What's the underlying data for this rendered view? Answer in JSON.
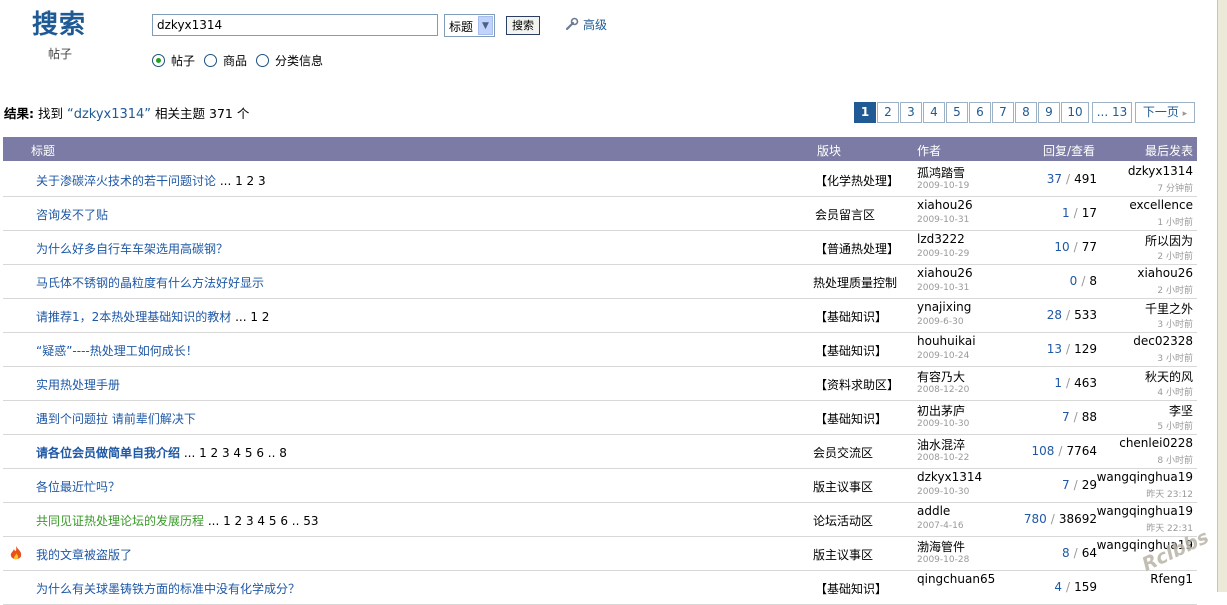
{
  "header": {
    "brand": "搜索",
    "brand_sub": "帖子",
    "query": "dzkyx1314",
    "field_value": "标题",
    "search_label": "搜索",
    "advanced_label": "高级",
    "scopes": [
      "帖子",
      "商品",
      "分类信息"
    ]
  },
  "result": {
    "prefix": "结果:",
    "found": " 找到 ",
    "keyword": "“dzkyx1314”",
    "suffix": " 相关主题 371 个"
  },
  "pager": {
    "pages": [
      "1",
      "2",
      "3",
      "4",
      "5",
      "6",
      "7",
      "8",
      "9",
      "10",
      "... 13"
    ],
    "next": "下一页"
  },
  "table": {
    "headers": [
      "标题",
      "版块",
      "作者",
      "回复/查看",
      "最后发表"
    ],
    "rows": [
      {
        "title": "关于渗碳淬火技术的若干问题讨论",
        "pages": " ... 1 2 3",
        "style": "blue",
        "forum": "【化学热处理】",
        "author": "孤鸿踏雪",
        "adate": "2009-10-19",
        "replies": "37",
        "views": "491",
        "last": "dzkyx1314",
        "ltime": "7 分钟前"
      },
      {
        "title": "咨询发不了贴",
        "pages": "",
        "style": "",
        "forum": "会员留言区",
        "author": "xiahou26",
        "adate": "2009-10-31",
        "replies": "1",
        "views": "17",
        "last": "excellence",
        "ltime": "1 小时前"
      },
      {
        "title": "为什么好多自行车车架选用高碳钢？",
        "pages": "",
        "style": "",
        "forum": "【普通热处理】",
        "author": "lzd3222",
        "adate": "2009-10-29",
        "replies": "10",
        "views": "77",
        "last": "所以因为",
        "ltime": "2 小时前"
      },
      {
        "title": "马氏体不锈钢的晶粒度有什么方法好好显示",
        "pages": "",
        "style": "",
        "forum": "热处理质量控制",
        "author": "xiahou26",
        "adate": "2009-10-31",
        "replies": "0",
        "views": "8",
        "last": "xiahou26",
        "ltime": "2 小时前"
      },
      {
        "title": "请推荐1，2本热处理基础知识的教材",
        "pages": " ... 1 2",
        "style": "",
        "forum": "【基础知识】",
        "author": "ynajixing",
        "adate": "2009-6-30",
        "replies": "28",
        "views": "533",
        "last": "千里之外",
        "ltime": "3 小时前"
      },
      {
        "title": "“疑惑”----热处理工如何成长！",
        "pages": "",
        "style": "",
        "forum": "【基础知识】",
        "author": "houhuikai",
        "adate": "2009-10-24",
        "replies": "13",
        "views": "129",
        "last": "dec02328",
        "ltime": "3 小时前"
      },
      {
        "title": "实用热处理手册",
        "pages": "",
        "style": "",
        "forum": "【资料求助区】",
        "author": "有容乃大",
        "adate": "2008-12-20",
        "replies": "1",
        "views": "463",
        "last": "秋天的风",
        "ltime": "4 小时前"
      },
      {
        "title": "遇到个问题拉 请前辈们解决下",
        "pages": "",
        "style": "",
        "forum": "【基础知识】",
        "author": "初出茅庐",
        "adate": "2009-10-30",
        "replies": "7",
        "views": "88",
        "last": "李坚",
        "ltime": "5 小时前"
      },
      {
        "title": "请各位会员做简单自我介绍",
        "pages": " ... 1 2 3 4 5 6 .. 8",
        "style": "bold",
        "forum": "会员交流区",
        "author": "油水混淬",
        "adate": "2008-10-22",
        "replies": "108",
        "views": "7764",
        "last": "chenlei0228",
        "ltime": "8 小时前"
      },
      {
        "title": "各位最近忙吗？",
        "pages": "",
        "style": "",
        "forum": "版主议事区",
        "author": "dzkyx1314",
        "adate": "2009-10-30",
        "replies": "7",
        "views": "29",
        "last": "wangqinghua19",
        "ltime": "昨天 23:12"
      },
      {
        "title": "共同见证热处理论坛的发展历程",
        "pages": " ... 1 2 3 4 5 6 .. 53",
        "style": "green",
        "forum": "论坛活动区",
        "author": "addle",
        "adate": "2007-4-16",
        "replies": "780",
        "views": "38692",
        "last": "wangqinghua19",
        "ltime": "昨天 22:31"
      },
      {
        "title": "我的文章被盗版了",
        "pages": "",
        "style": "",
        "forum": "版主议事区",
        "author": "渤海管件",
        "adate": "2009-10-28",
        "replies": "8",
        "views": "64",
        "last": "wangqinghua19",
        "ltime": "",
        "hot": true
      },
      {
        "title": "为什么有关球墨铸铁方面的标准中没有化学成分？",
        "pages": "",
        "style": "",
        "forum": "【基础知识】",
        "author": "qingchuan65",
        "adate": "",
        "replies": "4",
        "views": "159",
        "last": "Rfeng1",
        "ltime": ""
      }
    ]
  },
  "watermark": "Rclbbs",
  "colors": {
    "accent": "#1f5a94",
    "header_bg": "#7b7ba5",
    "link": "#1f58a5",
    "green": "#3a9a2a"
  }
}
